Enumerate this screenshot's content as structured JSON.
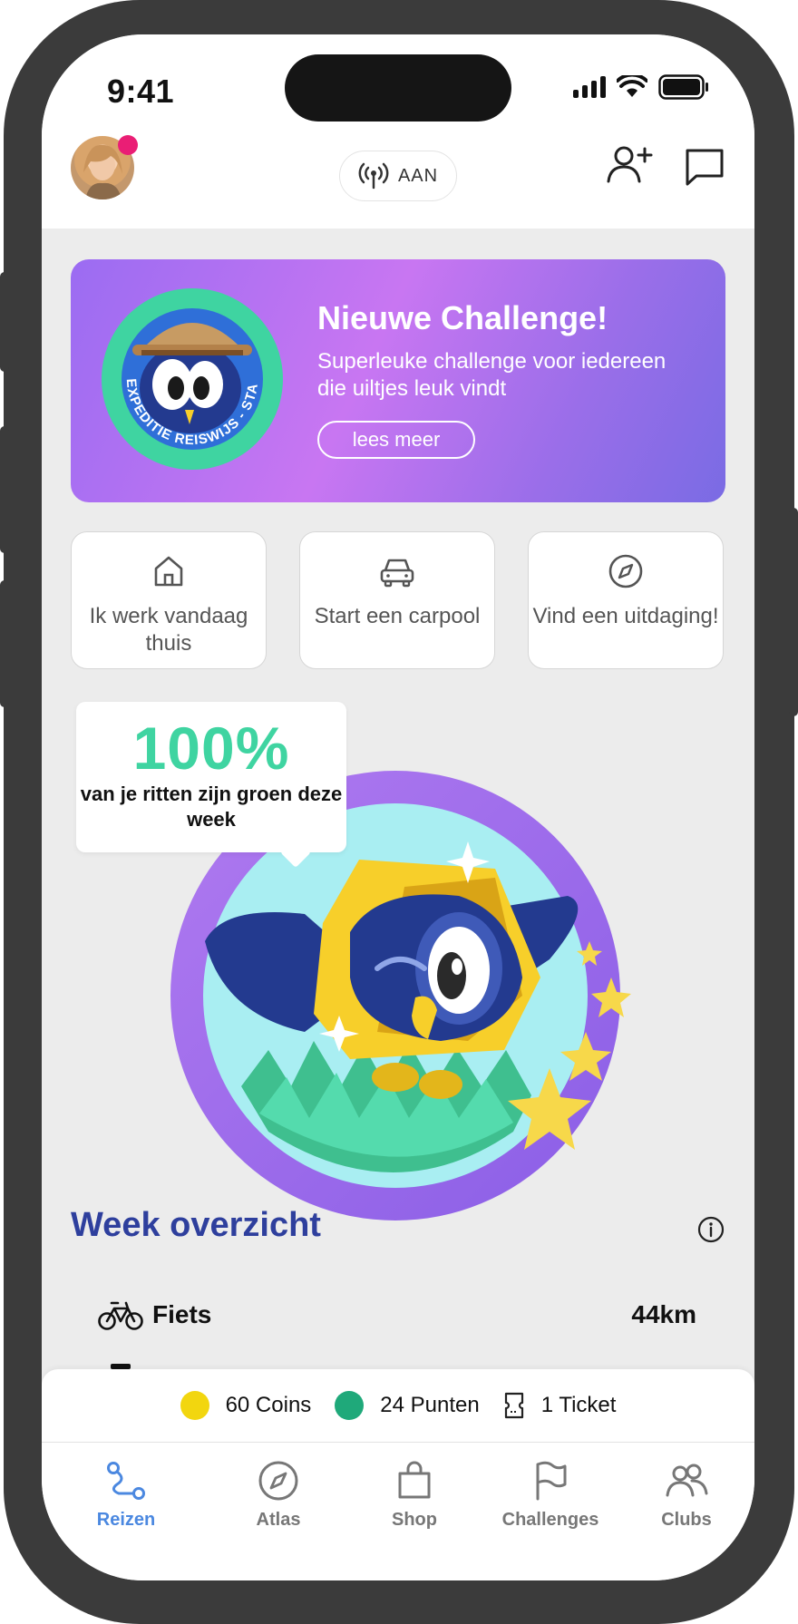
{
  "status_bar": {
    "time": "9:41"
  },
  "header": {
    "location_toggle": "AAN"
  },
  "banner": {
    "title": "Nieuwe Challenge!",
    "text": "Superleuke challenge voor iedereen die uiltjes leuk vindt",
    "button": "lees meer",
    "badge_text": "EXPEDITIE REISWIJS - START EDITIE"
  },
  "actions": [
    {
      "label": "Ik werk vandaag thuis",
      "icon": "home-icon"
    },
    {
      "label": "Start een carpool",
      "icon": "car-icon"
    },
    {
      "label": "Vind een uitdaging!",
      "icon": "compass-icon"
    }
  ],
  "green_stat": {
    "percent": "100%",
    "text": "van je ritten zijn groen deze week"
  },
  "week": {
    "title": "Week overzicht",
    "rows": [
      {
        "label": "Fiets",
        "value": "44km",
        "icon": "bike-icon"
      }
    ]
  },
  "rewards": [
    {
      "label": "60 Coins",
      "color": "#f2d60f"
    },
    {
      "label": "24 Punten",
      "color": "#1fa97a"
    },
    {
      "label": "1 Ticket",
      "icon": "ticket-icon"
    }
  ],
  "tabs": [
    {
      "label": "Reizen",
      "icon": "route-icon",
      "active": true
    },
    {
      "label": "Atlas",
      "icon": "compass-icon"
    },
    {
      "label": "Shop",
      "icon": "shopping-bag-icon"
    },
    {
      "label": "Challenges",
      "icon": "flag-icon"
    },
    {
      "label": "Clubs",
      "icon": "users-icon"
    }
  ],
  "colors": {
    "primary": "#2e3f9d",
    "accent_green": "#3fd4a1",
    "tab_active": "#4b88e0",
    "banner_purple": "#c876f2"
  }
}
